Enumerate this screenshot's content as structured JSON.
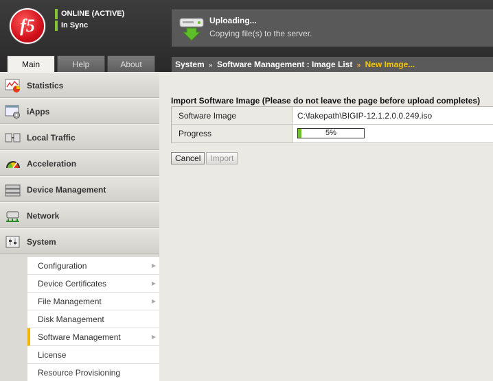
{
  "header": {
    "logo_text": "f5",
    "status": "ONLINE (ACTIVE)",
    "sync": "In Sync"
  },
  "tabs": [
    {
      "label": "Main",
      "active": true
    },
    {
      "label": "Help",
      "active": false
    },
    {
      "label": "About",
      "active": false
    }
  ],
  "upload": {
    "title": "Uploading...",
    "subtitle": "Copying file(s) to the server."
  },
  "breadcrumb": {
    "items": [
      "System",
      "Software Management : Image List"
    ],
    "current": "New Image...",
    "separator": "»"
  },
  "sidebar": {
    "items": [
      {
        "label": "Statistics",
        "icon": "statistics-icon"
      },
      {
        "label": "iApps",
        "icon": "iapps-icon"
      },
      {
        "label": "Local Traffic",
        "icon": "local-traffic-icon"
      },
      {
        "label": "Acceleration",
        "icon": "acceleration-icon"
      },
      {
        "label": "Device Management",
        "icon": "device-management-icon"
      },
      {
        "label": "Network",
        "icon": "network-icon"
      },
      {
        "label": "System",
        "icon": "system-icon"
      }
    ],
    "submenu": [
      {
        "label": "Configuration",
        "arrow": "▶"
      },
      {
        "label": "Device Certificates",
        "arrow": "▶"
      },
      {
        "label": "File Management",
        "arrow": "▶"
      },
      {
        "label": "Disk Management",
        "arrow": ""
      },
      {
        "label": "Software Management",
        "arrow": "▶",
        "selected": true
      },
      {
        "label": "License",
        "arrow": ""
      },
      {
        "label": "Resource Provisioning",
        "arrow": ""
      }
    ]
  },
  "content": {
    "section_title": "Import Software Image (Please do not leave the page before upload completes)",
    "rows": [
      {
        "label": "Software Image",
        "value": "C:\\fakepath\\BIGIP-12.1.2.0.0.249.iso"
      },
      {
        "label": "Progress",
        "value": ""
      }
    ],
    "progress_percent": 5,
    "progress_text": "5%",
    "buttons": {
      "cancel": "Cancel",
      "import": "Import"
    }
  },
  "colors": {
    "accent": "#f5c400",
    "status_green": "#86c232",
    "progress_green": "#6dbf2c",
    "brand_red": "#d1101b"
  }
}
